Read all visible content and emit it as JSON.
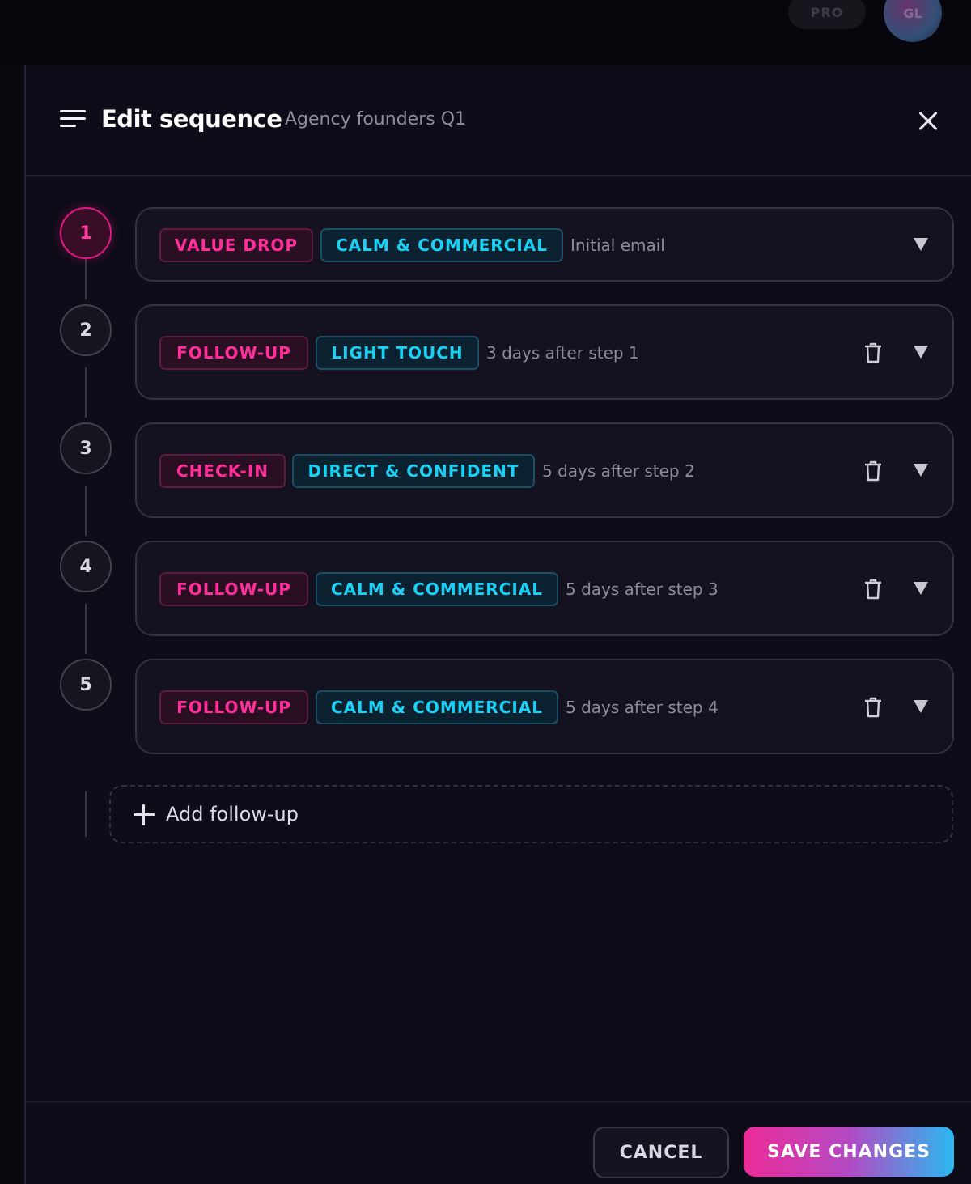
{
  "topbar": {
    "plan_badge": "PRO",
    "avatar_initials": "GL"
  },
  "header": {
    "title": "Edit sequence",
    "subtitle": "Agency founders Q1"
  },
  "steps": [
    {
      "number": "1",
      "type_tag": "VALUE DROP",
      "tone_tag": "CALM & COMMERCIAL",
      "description": "Initial email"
    },
    {
      "number": "2",
      "type_tag": "FOLLOW-UP",
      "tone_tag": "LIGHT TOUCH",
      "description": "3 days after step 1"
    },
    {
      "number": "3",
      "type_tag": "CHECK-IN",
      "tone_tag": "DIRECT & CONFIDENT",
      "description": "5 days after step 2"
    },
    {
      "number": "4",
      "type_tag": "FOLLOW-UP",
      "tone_tag": "CALM & COMMERCIAL",
      "description": "5 days after step 3"
    },
    {
      "number": "5",
      "type_tag": "FOLLOW-UP",
      "tone_tag": "CALM & COMMERCIAL",
      "description": "5 days after step 4"
    }
  ],
  "add_followup": {
    "label": "Add follow-up"
  },
  "footer": {
    "cancel_label": "CANCEL",
    "save_label": "SAVE CHANGES"
  },
  "colors": {
    "accent_pink": "#ff2e9b",
    "accent_cyan": "#1ad0f5",
    "background": "#0e0c19"
  }
}
